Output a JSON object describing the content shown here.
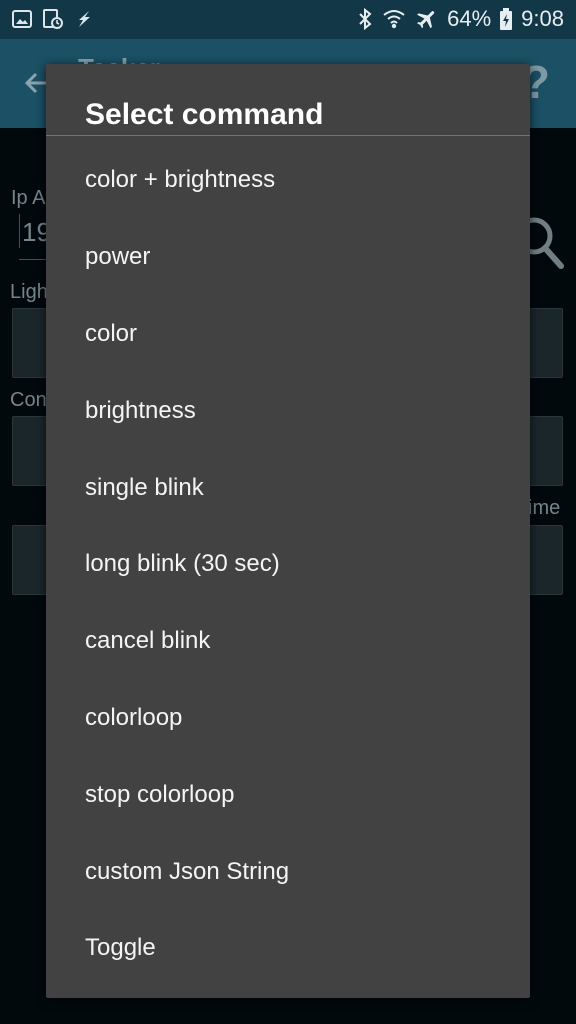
{
  "status_bar": {
    "battery_percent": "64%",
    "time": "9:08",
    "icons": [
      "image-icon",
      "calendar-icon",
      "flash-icon",
      "bluetooth-icon",
      "wifi-icon",
      "airplane-mode-icon",
      "battery-charging-icon"
    ]
  },
  "app_bar": {
    "title": "Tasker",
    "help_label": "?"
  },
  "background_form": {
    "ip_label": "Ip A",
    "ip_value": "19",
    "light_label": "Ligh",
    "command_label": "Con",
    "time_label": "ime"
  },
  "dialog": {
    "title": "Select command",
    "options": [
      "color + brightness",
      "power",
      "color",
      "brightness",
      "single blink",
      "long blink (30 sec)",
      "cancel blink",
      "colorloop",
      "stop colorloop",
      "custom Json String",
      "Toggle"
    ]
  },
  "colors": {
    "status_bar": "#123848",
    "app_bar": "#1b5065",
    "dialog_background": "#424242",
    "screen_background": "#02090d"
  }
}
